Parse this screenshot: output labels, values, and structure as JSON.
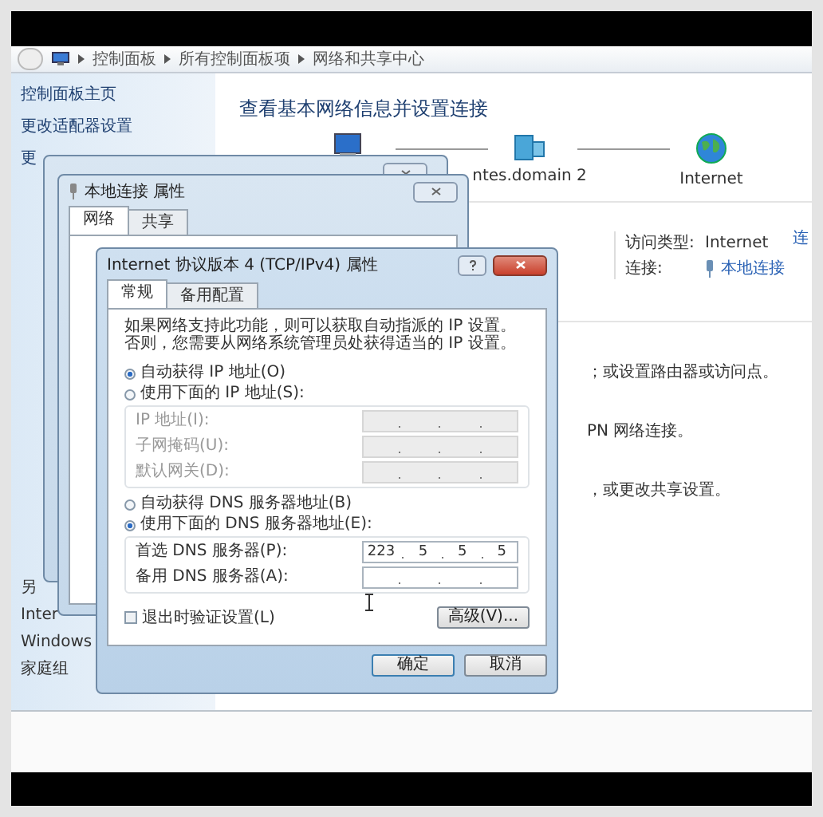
{
  "address_bar": {
    "crumbs": [
      "控制面板",
      "所有控制面板项",
      "网络和共享中心"
    ]
  },
  "sidebar": {
    "items": [
      "控制面板主页",
      "更改适配器设置",
      "更"
    ],
    "see_also": [
      "另",
      "Inter",
      "Windows",
      "家庭组"
    ]
  },
  "main": {
    "title": "查看基本网络信息并设置连接",
    "network_map": [
      {
        "kind": "computer"
      },
      {
        "kind": "domain",
        "label": "ntes.domain  2"
      },
      {
        "kind": "internet",
        "label": "Internet"
      }
    ],
    "edge_link": "连",
    "access": [
      {
        "kind": "text",
        "label": "访问类型:",
        "value": "Internet"
      },
      {
        "kind": "link",
        "label": "连接:",
        "value": "本地连接"
      }
    ],
    "tasks": [
      "；或设置路由器或访问点。",
      "PN 网络连接。",
      "，或更改共享设置。"
    ]
  },
  "properties_dialog": {
    "title": "本地连接 属性",
    "tabs": [
      {
        "label": "网络",
        "selected": true
      },
      {
        "label": "共享",
        "selected": false
      }
    ]
  },
  "ipv4_dialog": {
    "title": "Internet 协议版本 4 (TCP/IPv4) 属性",
    "tabs": [
      {
        "label": "常规",
        "selected": true
      },
      {
        "label": "备用配置",
        "selected": false
      }
    ],
    "description": "如果网络支持此功能，则可以获取自动指派的 IP 设置。否则，您需要从网络系统管理员处获得适当的 IP 设置。",
    "ip_mode": [
      {
        "label": "自动获得 IP 地址(O)",
        "selected": true
      },
      {
        "label": "使用下面的 IP 地址(S):",
        "selected": false
      }
    ],
    "ip_fields": [
      {
        "label": "IP 地址(I):",
        "disabled": true
      },
      {
        "label": "子网掩码(U):",
        "disabled": true
      },
      {
        "label": "默认网关(D):",
        "disabled": true
      }
    ],
    "dns_mode": [
      {
        "label": "自动获得 DNS 服务器地址(B)",
        "selected": false
      },
      {
        "label": "使用下面的 DNS 服务器地址(E):",
        "selected": true
      }
    ],
    "dns_fields": [
      {
        "label": "首选 DNS 服务器(P):",
        "disabled": false,
        "segments": [
          "223",
          "5",
          "5",
          "5"
        ]
      },
      {
        "label": "备用 DNS 服务器(A):",
        "disabled": false
      }
    ],
    "validate": {
      "label": "退出时验证设置(L)",
      "checked": false
    },
    "advanced_button": "高级(V)...",
    "buttons": [
      "确定",
      "取消"
    ]
  }
}
